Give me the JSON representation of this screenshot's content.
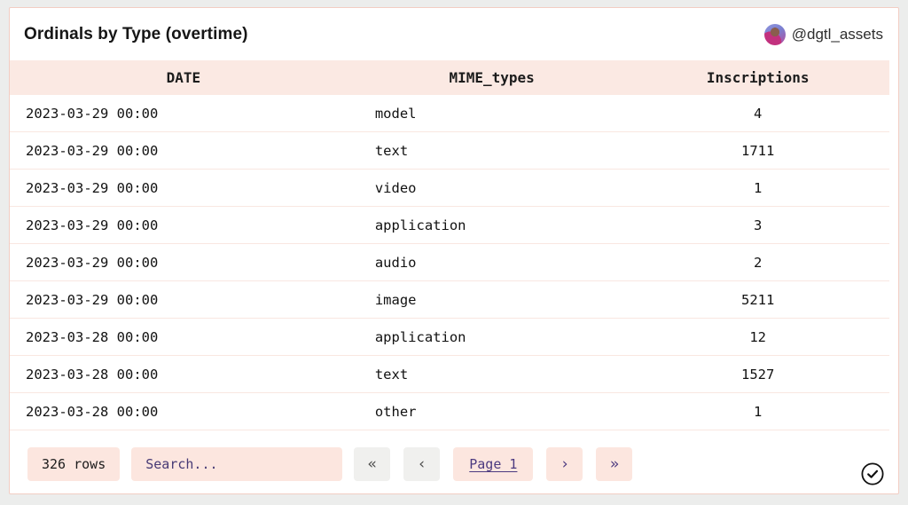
{
  "card": {
    "title": "Ordinals by Type (overtime)",
    "author_handle": "@dgtl_assets"
  },
  "table": {
    "columns": {
      "date": "DATE",
      "mime": "MIME_types",
      "inscriptions": "Inscriptions"
    },
    "rows": [
      [
        "2023-03-29 00:00",
        "model",
        "4"
      ],
      [
        "2023-03-29 00:00",
        "text",
        "1711"
      ],
      [
        "2023-03-29 00:00",
        "video",
        "1"
      ],
      [
        "2023-03-29 00:00",
        "application",
        "3"
      ],
      [
        "2023-03-29 00:00",
        "audio",
        "2"
      ],
      [
        "2023-03-29 00:00",
        "image",
        "5211"
      ],
      [
        "2023-03-28 00:00",
        "application",
        "12"
      ],
      [
        "2023-03-28 00:00",
        "text",
        "1527"
      ],
      [
        "2023-03-28 00:00",
        "other",
        "1"
      ]
    ]
  },
  "footer": {
    "row_count": "326 rows",
    "search_placeholder": "Search...",
    "pagination": {
      "first": "«",
      "prev": "‹",
      "page_label": "Page 1",
      "next": "›",
      "last": "»"
    }
  },
  "colors": {
    "accent_pink_band": "#fbe9e3",
    "control_pink": "#fce6df",
    "control_gray": "#f0f0ee",
    "link_purple": "#4c3a80",
    "card_border": "#f2cdc3"
  }
}
